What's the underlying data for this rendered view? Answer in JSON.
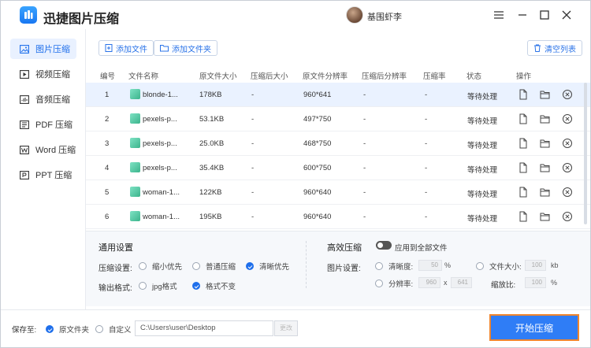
{
  "app": {
    "title": "迅捷图片压缩",
    "user_name": "基围虾李"
  },
  "colors": {
    "accent": "#2f7df6",
    "active_bg": "#e9f1ff",
    "start_border": "#f0852d"
  },
  "sidebar": {
    "items": [
      {
        "label": "图片压缩",
        "icon": "image-icon",
        "active": true
      },
      {
        "label": "视频压缩",
        "icon": "video-icon"
      },
      {
        "label": "音频压缩",
        "icon": "audio-icon"
      },
      {
        "label": "PDF 压缩",
        "icon": "pdf-icon"
      },
      {
        "label": "Word 压缩",
        "icon": "word-icon"
      },
      {
        "label": "PPT 压缩",
        "icon": "ppt-icon"
      }
    ]
  },
  "toolbar": {
    "add_file": "添加文件",
    "add_folder": "添加文件夹",
    "clear_list": "清空列表"
  },
  "table": {
    "headers": [
      "编号",
      "文件名称",
      "原文件大小",
      "压缩后大小",
      "原文件分辨率",
      "压缩后分辨率",
      "压缩率",
      "状态",
      "操作"
    ],
    "rows": [
      {
        "no": "1",
        "name": "blonde-1...",
        "size": "178KB",
        "csize": "-",
        "res": "960*641",
        "cres": "-",
        "ratio": "-",
        "status": "等待处理"
      },
      {
        "no": "2",
        "name": "pexels-p...",
        "size": "53.1KB",
        "csize": "-",
        "res": "497*750",
        "cres": "-",
        "ratio": "-",
        "status": "等待处理"
      },
      {
        "no": "3",
        "name": "pexels-p...",
        "size": "25.0KB",
        "csize": "-",
        "res": "468*750",
        "cres": "-",
        "ratio": "-",
        "status": "等待处理"
      },
      {
        "no": "4",
        "name": "pexels-p...",
        "size": "35.4KB",
        "csize": "-",
        "res": "600*750",
        "cres": "-",
        "ratio": "-",
        "status": "等待处理"
      },
      {
        "no": "5",
        "name": "woman-1...",
        "size": "122KB",
        "csize": "-",
        "res": "960*640",
        "cres": "-",
        "ratio": "-",
        "status": "等待处理"
      },
      {
        "no": "6",
        "name": "woman-1...",
        "size": "195KB",
        "csize": "-",
        "res": "960*640",
        "cres": "-",
        "ratio": "-",
        "status": "等待处理"
      }
    ]
  },
  "general": {
    "title": "通用设置",
    "compress_label": "压缩设置:",
    "compress_options": [
      "缩小优先",
      "普通压缩",
      "清晰优先"
    ],
    "compress_selected": "清晰优先",
    "format_label": "输出格式:",
    "format_options": [
      "jpg格式",
      "格式不变"
    ],
    "format_selected": "格式不变"
  },
  "advanced": {
    "title": "高效压缩",
    "apply_all": "应用到全部文件",
    "image_label": "图片设置:",
    "clarity_label": "清晰度:",
    "clarity_value": "50",
    "clarity_unit": "%",
    "filesize_label": "文件大小:",
    "filesize_value": "100",
    "filesize_unit": "kb",
    "resolution_label": "分辨率:",
    "res_w": "960",
    "res_x": "x",
    "res_h": "641",
    "scale_label": "缩放比:",
    "scale_value": "100",
    "scale_unit": "%"
  },
  "footer": {
    "save_label": "保存至:",
    "opt_original": "原文件夹",
    "opt_custom": "自定义",
    "path": "C:\\Users\\user\\Desktop",
    "change": "更改",
    "start": "开始压缩"
  }
}
